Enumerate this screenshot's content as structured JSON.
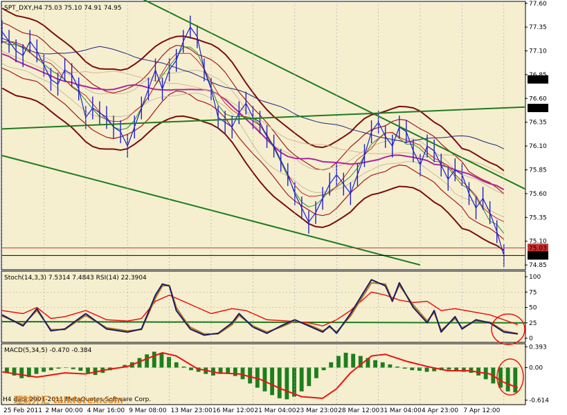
{
  "colors": {
    "plot_bg": "#f5efcf",
    "price": "#1f1fcc",
    "bb_outer": "#7a0c0c",
    "bb_inner": "#a51818",
    "ma_magenta": "#b0269a",
    "ma_navy": "#22227a",
    "ma_orange": "#d9b48a",
    "ma_tan": "#c6bca0",
    "ma_green": "#2f8a2f",
    "ma_red": "#cc2222",
    "trendline": "#1e7a1e",
    "price_hline": "#c83232",
    "stoch_main": "#1a1a66",
    "stoch_signal": "#b07722",
    "rsi": "#ee1111",
    "macd_hist": "#1e7e1e",
    "macd_signal": "#ee1111",
    "highlight": "#ee1111"
  },
  "main_panel": {
    "title": "SPT_DXY,H4  75.03 75.10 74.91 74.95",
    "y_ticks": [
      "77.60",
      "77.35",
      "77.10",
      "76.85",
      "76.60",
      "76.35",
      "76.10",
      "75.85",
      "75.60",
      "75.35",
      "75.10",
      "74.85"
    ],
    "hline_labels": [
      {
        "text": "76.80",
        "value": 76.8
      },
      {
        "text": "76.50",
        "value": 76.5
      },
      {
        "text": "75.03",
        "value": 75.03
      },
      {
        "text": "74.95",
        "value": 74.95
      }
    ]
  },
  "stoch_panel": {
    "title": "Stoch(14,3,3) 7.5314 7.4843  RSI(14) 22.3904",
    "y_ticks": [
      "100",
      "75",
      "50",
      "25",
      "0"
    ]
  },
  "macd_panel": {
    "title": "MACD(5,34,5) -0.470 -0.384",
    "y_ticks": [
      "0.393",
      "0.00",
      "-0.614"
    ]
  },
  "x_axis": {
    "labels": [
      "25 Feb 2011",
      "2 Mar 00:00",
      "4 Mar 16:00",
      "9 Mar 08:00",
      "13 Mar 23:00",
      "16 Mar 12:00",
      "21 Mar 04:00",
      "23 Mar 23:00",
      "28 Mar 12:00",
      "31 Mar 04:00",
      "4 Apr 23:00",
      "7 Apr 12:00"
    ]
  },
  "footer": {
    "copyright": "H4 data 2001-2011 MetaQuotes Software Corp.",
    "watermark": "理财外汇 talkforex.com"
  },
  "chart_data": {
    "type": "line",
    "symbol": "SPT_DXY",
    "timeframe": "H4",
    "ohlc_last": {
      "open": 75.03,
      "high": 75.1,
      "low": 74.91,
      "close": 74.95
    },
    "price_ylim": [
      74.8,
      77.62
    ],
    "x": [
      "25 Feb 2011",
      "2 Mar 00:00",
      "4 Mar 16:00",
      "9 Mar 08:00",
      "13 Mar 23:00",
      "16 Mar 12:00",
      "21 Mar 04:00",
      "23 Mar 23:00",
      "28 Mar 12:00",
      "31 Mar 04:00",
      "4 Apr 23:00",
      "7 Apr 12:00"
    ],
    "close_path": [
      [
        0,
        77.3
      ],
      [
        4,
        77.2
      ],
      [
        8,
        77.1
      ],
      [
        12,
        77.05
      ],
      [
        16,
        77.2
      ],
      [
        20,
        77.1
      ],
      [
        24,
        76.95
      ],
      [
        28,
        76.8
      ],
      [
        32,
        76.75
      ],
      [
        36,
        76.9
      ],
      [
        40,
        76.85
      ],
      [
        44,
        76.7
      ],
      [
        48,
        76.4
      ],
      [
        52,
        76.5
      ],
      [
        56,
        76.45
      ],
      [
        60,
        76.4
      ],
      [
        64,
        76.3
      ],
      [
        68,
        76.25
      ],
      [
        72,
        76.1
      ],
      [
        76,
        76.3
      ],
      [
        80,
        76.5
      ],
      [
        84,
        76.7
      ],
      [
        88,
        76.9
      ],
      [
        92,
        76.7
      ],
      [
        96,
        76.9
      ],
      [
        100,
        77.0
      ],
      [
        104,
        77.2
      ],
      [
        108,
        77.35
      ],
      [
        112,
        77.25
      ],
      [
        116,
        76.9
      ],
      [
        120,
        76.7
      ],
      [
        124,
        76.4
      ],
      [
        128,
        76.35
      ],
      [
        132,
        76.3
      ],
      [
        136,
        76.45
      ],
      [
        140,
        76.55
      ],
      [
        144,
        76.4
      ],
      [
        148,
        76.35
      ],
      [
        152,
        76.2
      ],
      [
        156,
        76.1
      ],
      [
        160,
        75.95
      ],
      [
        164,
        75.8
      ],
      [
        168,
        75.6
      ],
      [
        172,
        75.45
      ],
      [
        176,
        75.3
      ],
      [
        180,
        75.4
      ],
      [
        184,
        75.55
      ],
      [
        188,
        75.7
      ],
      [
        192,
        75.8
      ],
      [
        196,
        75.7
      ],
      [
        200,
        75.6
      ],
      [
        204,
        75.8
      ],
      [
        208,
        76.0
      ],
      [
        212,
        76.25
      ],
      [
        216,
        76.35
      ],
      [
        220,
        76.2
      ],
      [
        224,
        76.1
      ],
      [
        228,
        76.3
      ],
      [
        232,
        76.25
      ],
      [
        236,
        76.05
      ],
      [
        240,
        75.9
      ],
      [
        244,
        76.1
      ],
      [
        248,
        76.05
      ],
      [
        252,
        75.9
      ],
      [
        256,
        75.75
      ],
      [
        260,
        75.85
      ],
      [
        264,
        75.8
      ],
      [
        268,
        75.6
      ],
      [
        272,
        75.45
      ],
      [
        276,
        75.55
      ],
      [
        280,
        75.4
      ],
      [
        284,
        75.2
      ],
      [
        288,
        74.95
      ]
    ],
    "trendlines": [
      {
        "name": "upper_channel",
        "points": [
          [
            0,
            76.28
          ],
          [
            300,
            76.51
          ]
        ]
      },
      {
        "name": "falling_resistance",
        "points": [
          [
            80,
            77.65
          ],
          [
            300,
            75.65
          ]
        ]
      },
      {
        "name": "lower_channel",
        "points": [
          [
            0,
            76.0
          ],
          [
            240,
            74.85
          ]
        ]
      }
    ],
    "stochastic": {
      "params": "14,3,3",
      "main": 7.5314,
      "signal": 7.4843,
      "ylim": [
        0,
        100
      ],
      "main_path": [
        [
          0,
          38
        ],
        [
          12,
          20
        ],
        [
          20,
          48
        ],
        [
          28,
          12
        ],
        [
          36,
          15
        ],
        [
          48,
          40
        ],
        [
          60,
          15
        ],
        [
          72,
          10
        ],
        [
          80,
          15
        ],
        [
          88,
          70
        ],
        [
          92,
          88
        ],
        [
          96,
          85
        ],
        [
          100,
          45
        ],
        [
          104,
          30
        ],
        [
          108,
          15
        ],
        [
          116,
          5
        ],
        [
          124,
          8
        ],
        [
          132,
          25
        ],
        [
          136,
          40
        ],
        [
          144,
          18
        ],
        [
          152,
          8
        ],
        [
          160,
          20
        ],
        [
          168,
          30
        ],
        [
          176,
          20
        ],
        [
          184,
          10
        ],
        [
          188,
          20
        ],
        [
          192,
          8
        ],
        [
          200,
          40
        ],
        [
          212,
          95
        ],
        [
          220,
          85
        ],
        [
          224,
          60
        ],
        [
          228,
          90
        ],
        [
          236,
          50
        ],
        [
          244,
          25
        ],
        [
          248,
          45
        ],
        [
          252,
          10
        ],
        [
          260,
          35
        ],
        [
          264,
          15
        ],
        [
          272,
          30
        ],
        [
          280,
          25
        ],
        [
          288,
          10
        ],
        [
          296,
          7
        ]
      ],
      "signal_path": [
        [
          0,
          36
        ],
        [
          12,
          22
        ],
        [
          20,
          45
        ],
        [
          28,
          14
        ],
        [
          36,
          14
        ],
        [
          48,
          37
        ],
        [
          60,
          17
        ],
        [
          72,
          12
        ],
        [
          80,
          14
        ],
        [
          88,
          65
        ],
        [
          92,
          85
        ],
        [
          96,
          86
        ],
        [
          100,
          50
        ],
        [
          104,
          33
        ],
        [
          108,
          18
        ],
        [
          116,
          7
        ],
        [
          124,
          7
        ],
        [
          132,
          22
        ],
        [
          136,
          37
        ],
        [
          144,
          20
        ],
        [
          152,
          10
        ],
        [
          160,
          18
        ],
        [
          168,
          28
        ],
        [
          176,
          22
        ],
        [
          184,
          12
        ],
        [
          188,
          18
        ],
        [
          192,
          10
        ],
        [
          200,
          36
        ],
        [
          212,
          90
        ],
        [
          220,
          88
        ],
        [
          224,
          62
        ],
        [
          228,
          86
        ],
        [
          236,
          54
        ],
        [
          244,
          28
        ],
        [
          248,
          42
        ],
        [
          252,
          13
        ],
        [
          260,
          32
        ],
        [
          264,
          17
        ],
        [
          272,
          28
        ],
        [
          280,
          26
        ],
        [
          288,
          12
        ],
        [
          296,
          7.5
        ]
      ]
    },
    "rsi": {
      "period": 14,
      "value": 22.3904,
      "path": [
        [
          0,
          45
        ],
        [
          12,
          40
        ],
        [
          20,
          50
        ],
        [
          28,
          32
        ],
        [
          36,
          35
        ],
        [
          48,
          45
        ],
        [
          60,
          30
        ],
        [
          72,
          28
        ],
        [
          80,
          32
        ],
        [
          88,
          60
        ],
        [
          96,
          70
        ],
        [
          104,
          60
        ],
        [
          112,
          50
        ],
        [
          120,
          40
        ],
        [
          132,
          48
        ],
        [
          140,
          45
        ],
        [
          152,
          30
        ],
        [
          164,
          28
        ],
        [
          176,
          25
        ],
        [
          184,
          20
        ],
        [
          192,
          30
        ],
        [
          200,
          45
        ],
        [
          212,
          75
        ],
        [
          220,
          70
        ],
        [
          228,
          62
        ],
        [
          236,
          58
        ],
        [
          244,
          60
        ],
        [
          252,
          45
        ],
        [
          260,
          48
        ],
        [
          272,
          42
        ],
        [
          280,
          38
        ],
        [
          288,
          30
        ],
        [
          296,
          22
        ]
      ]
    },
    "macd": {
      "params": "5,34,5",
      "main": -0.47,
      "signal": -0.384,
      "ylim": [
        -0.7,
        0.45
      ],
      "hist": [
        -0.1,
        -0.15,
        -0.2,
        -0.18,
        -0.12,
        -0.08,
        -0.05,
        -0.02,
        0.0,
        -0.03,
        -0.06,
        -0.1,
        -0.14,
        -0.1,
        -0.05,
        0.0,
        0.05,
        0.1,
        0.18,
        0.25,
        0.3,
        0.28,
        0.2,
        0.1,
        0.02,
        -0.05,
        -0.08,
        -0.12,
        -0.15,
        -0.12,
        -0.1,
        -0.16,
        -0.22,
        -0.3,
        -0.38,
        -0.45,
        -0.52,
        -0.58,
        -0.6,
        -0.55,
        -0.45,
        -0.35,
        -0.2,
        -0.05,
        0.1,
        0.22,
        0.28,
        0.26,
        0.22,
        0.18,
        0.14,
        0.1,
        0.06,
        0.02,
        -0.02,
        -0.05,
        -0.06,
        -0.08,
        -0.07,
        -0.05,
        -0.04,
        -0.06,
        -0.08,
        -0.1,
        -0.15,
        -0.22,
        -0.3,
        -0.38,
        -0.45,
        -0.47
      ],
      "signal_path": [
        [
          0,
          -0.08
        ],
        [
          20,
          -0.18
        ],
        [
          36,
          -0.1
        ],
        [
          48,
          -0.12
        ],
        [
          60,
          -0.04
        ],
        [
          72,
          0.02
        ],
        [
          84,
          0.18
        ],
        [
          92,
          0.28
        ],
        [
          100,
          0.22
        ],
        [
          112,
          -0.02
        ],
        [
          124,
          -0.1
        ],
        [
          136,
          -0.12
        ],
        [
          148,
          -0.22
        ],
        [
          160,
          -0.4
        ],
        [
          172,
          -0.55
        ],
        [
          184,
          -0.58
        ],
        [
          192,
          -0.4
        ],
        [
          200,
          -0.1
        ],
        [
          212,
          0.22
        ],
        [
          220,
          0.25
        ],
        [
          232,
          0.12
        ],
        [
          244,
          0.02
        ],
        [
          256,
          -0.06
        ],
        [
          268,
          -0.06
        ],
        [
          280,
          -0.12
        ],
        [
          288,
          -0.28
        ],
        [
          296,
          -0.38
        ]
      ]
    }
  }
}
